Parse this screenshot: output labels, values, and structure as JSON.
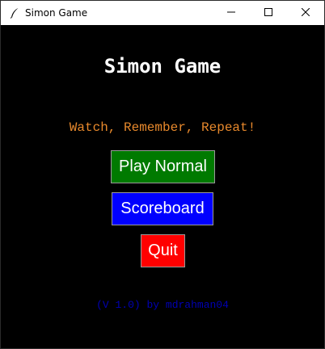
{
  "window": {
    "title": "Simon Game",
    "icon": "feather-icon",
    "controls": {
      "minimize_icon": "minimize-icon",
      "maximize_icon": "maximize-icon",
      "close_icon": "close-icon"
    }
  },
  "main": {
    "title": "Simon Game",
    "tagline": "Watch, Remember, Repeat!",
    "buttons": {
      "play_normal": "Play Normal",
      "scoreboard": "Scoreboard",
      "quit": "Quit"
    },
    "version": "(V 1.0) by mdrahman04"
  },
  "colors": {
    "background": "#000000",
    "title_text": "#ffffff",
    "tagline_text": "#e8892c",
    "play_button": "#007a00",
    "scoreboard_button": "#0000ff",
    "quit_button": "#ff0000",
    "version_text": "#0000b4"
  }
}
